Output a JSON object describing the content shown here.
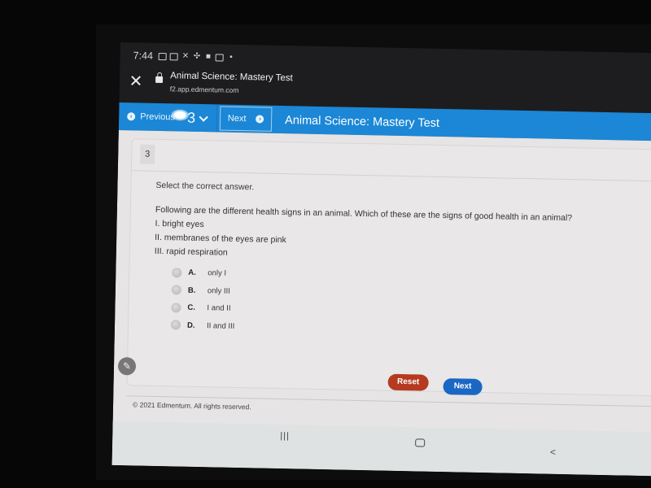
{
  "status_bar": {
    "time": "7:44",
    "icons": [
      "gallery-icon",
      "gallery-icon",
      "tools-icon",
      "pinwheel-icon",
      "bag-icon",
      "app-icon",
      "lock-icon"
    ]
  },
  "browser": {
    "close_icon": "close-icon",
    "secure_icon": "lock-icon",
    "page_title": "Animal Science: Mastery Test",
    "url": "f2.app.edmentum.com"
  },
  "test_nav": {
    "previous_label": "Previous",
    "question_number": "3",
    "next_label": "Next",
    "title": "Animal Science: Mastery Test",
    "colors": {
      "bar": "#1b87d6"
    }
  },
  "question": {
    "number": "3",
    "instruction": "Select the correct answer.",
    "stem": "Following are the different health signs in an animal. Which of these are the signs of good health in an animal?",
    "statements": [
      "I. bright eyes",
      "II. membranes of the eyes are pink",
      "III. rapid respiration"
    ],
    "options": [
      {
        "letter": "A.",
        "text": "only I"
      },
      {
        "letter": "B.",
        "text": "only III"
      },
      {
        "letter": "C.",
        "text": "I and II"
      },
      {
        "letter": "D.",
        "text": "II and III"
      }
    ]
  },
  "actions": {
    "reset_label": "Reset",
    "next_label": "Next",
    "colors": {
      "reset": "#b53a20",
      "next": "#1a67c4"
    }
  },
  "footer": {
    "copyright": "© 2021 Edmentum. All rights reserved."
  },
  "system_nav": {
    "recents": "|||",
    "back": "<"
  }
}
